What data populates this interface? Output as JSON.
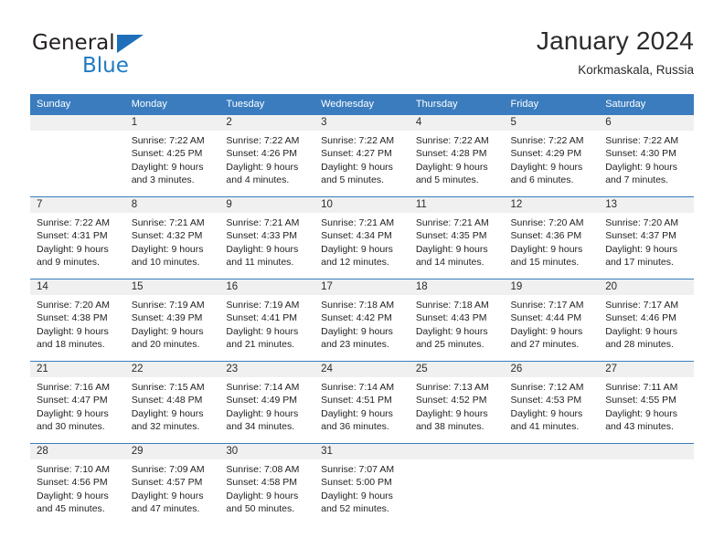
{
  "brand": {
    "name_top": "General",
    "name_bottom": "Blue",
    "triangle_color": "#1e6fba",
    "blue_color": "#1e7bc4"
  },
  "header": {
    "title": "January 2024",
    "subtitle": "Korkmaskala, Russia"
  },
  "colors": {
    "header_row_bg": "#3a7cbe",
    "header_row_text": "#ffffff",
    "daynum_band_bg": "#f0f0f0",
    "week_separator": "#3a7cbe"
  },
  "weekday_headers": [
    "Sunday",
    "Monday",
    "Tuesday",
    "Wednesday",
    "Thursday",
    "Friday",
    "Saturday"
  ],
  "labels": {
    "sunrise_prefix": "Sunrise:",
    "sunset_prefix": "Sunset:",
    "daylight_prefix": "Daylight:"
  },
  "weeks": [
    {
      "days": [
        {
          "date": "",
          "sunrise": "",
          "sunset": "",
          "daylight": "",
          "empty": true
        },
        {
          "date": "1",
          "sunrise": "Sunrise: 7:22 AM",
          "sunset": "Sunset: 4:25 PM",
          "daylight": "Daylight: 9 hours and 3 minutes.",
          "empty": false
        },
        {
          "date": "2",
          "sunrise": "Sunrise: 7:22 AM",
          "sunset": "Sunset: 4:26 PM",
          "daylight": "Daylight: 9 hours and 4 minutes.",
          "empty": false
        },
        {
          "date": "3",
          "sunrise": "Sunrise: 7:22 AM",
          "sunset": "Sunset: 4:27 PM",
          "daylight": "Daylight: 9 hours and 5 minutes.",
          "empty": false
        },
        {
          "date": "4",
          "sunrise": "Sunrise: 7:22 AM",
          "sunset": "Sunset: 4:28 PM",
          "daylight": "Daylight: 9 hours and 5 minutes.",
          "empty": false
        },
        {
          "date": "5",
          "sunrise": "Sunrise: 7:22 AM",
          "sunset": "Sunset: 4:29 PM",
          "daylight": "Daylight: 9 hours and 6 minutes.",
          "empty": false
        },
        {
          "date": "6",
          "sunrise": "Sunrise: 7:22 AM",
          "sunset": "Sunset: 4:30 PM",
          "daylight": "Daylight: 9 hours and 7 minutes.",
          "empty": false
        }
      ]
    },
    {
      "days": [
        {
          "date": "7",
          "sunrise": "Sunrise: 7:22 AM",
          "sunset": "Sunset: 4:31 PM",
          "daylight": "Daylight: 9 hours and 9 minutes.",
          "empty": false
        },
        {
          "date": "8",
          "sunrise": "Sunrise: 7:21 AM",
          "sunset": "Sunset: 4:32 PM",
          "daylight": "Daylight: 9 hours and 10 minutes.",
          "empty": false
        },
        {
          "date": "9",
          "sunrise": "Sunrise: 7:21 AM",
          "sunset": "Sunset: 4:33 PM",
          "daylight": "Daylight: 9 hours and 11 minutes.",
          "empty": false
        },
        {
          "date": "10",
          "sunrise": "Sunrise: 7:21 AM",
          "sunset": "Sunset: 4:34 PM",
          "daylight": "Daylight: 9 hours and 12 minutes.",
          "empty": false
        },
        {
          "date": "11",
          "sunrise": "Sunrise: 7:21 AM",
          "sunset": "Sunset: 4:35 PM",
          "daylight": "Daylight: 9 hours and 14 minutes.",
          "empty": false
        },
        {
          "date": "12",
          "sunrise": "Sunrise: 7:20 AM",
          "sunset": "Sunset: 4:36 PM",
          "daylight": "Daylight: 9 hours and 15 minutes.",
          "empty": false
        },
        {
          "date": "13",
          "sunrise": "Sunrise: 7:20 AM",
          "sunset": "Sunset: 4:37 PM",
          "daylight": "Daylight: 9 hours and 17 minutes.",
          "empty": false
        }
      ]
    },
    {
      "days": [
        {
          "date": "14",
          "sunrise": "Sunrise: 7:20 AM",
          "sunset": "Sunset: 4:38 PM",
          "daylight": "Daylight: 9 hours and 18 minutes.",
          "empty": false
        },
        {
          "date": "15",
          "sunrise": "Sunrise: 7:19 AM",
          "sunset": "Sunset: 4:39 PM",
          "daylight": "Daylight: 9 hours and 20 minutes.",
          "empty": false
        },
        {
          "date": "16",
          "sunrise": "Sunrise: 7:19 AM",
          "sunset": "Sunset: 4:41 PM",
          "daylight": "Daylight: 9 hours and 21 minutes.",
          "empty": false
        },
        {
          "date": "17",
          "sunrise": "Sunrise: 7:18 AM",
          "sunset": "Sunset: 4:42 PM",
          "daylight": "Daylight: 9 hours and 23 minutes.",
          "empty": false
        },
        {
          "date": "18",
          "sunrise": "Sunrise: 7:18 AM",
          "sunset": "Sunset: 4:43 PM",
          "daylight": "Daylight: 9 hours and 25 minutes.",
          "empty": false
        },
        {
          "date": "19",
          "sunrise": "Sunrise: 7:17 AM",
          "sunset": "Sunset: 4:44 PM",
          "daylight": "Daylight: 9 hours and 27 minutes.",
          "empty": false
        },
        {
          "date": "20",
          "sunrise": "Sunrise: 7:17 AM",
          "sunset": "Sunset: 4:46 PM",
          "daylight": "Daylight: 9 hours and 28 minutes.",
          "empty": false
        }
      ]
    },
    {
      "days": [
        {
          "date": "21",
          "sunrise": "Sunrise: 7:16 AM",
          "sunset": "Sunset: 4:47 PM",
          "daylight": "Daylight: 9 hours and 30 minutes.",
          "empty": false
        },
        {
          "date": "22",
          "sunrise": "Sunrise: 7:15 AM",
          "sunset": "Sunset: 4:48 PM",
          "daylight": "Daylight: 9 hours and 32 minutes.",
          "empty": false
        },
        {
          "date": "23",
          "sunrise": "Sunrise: 7:14 AM",
          "sunset": "Sunset: 4:49 PM",
          "daylight": "Daylight: 9 hours and 34 minutes.",
          "empty": false
        },
        {
          "date": "24",
          "sunrise": "Sunrise: 7:14 AM",
          "sunset": "Sunset: 4:51 PM",
          "daylight": "Daylight: 9 hours and 36 minutes.",
          "empty": false
        },
        {
          "date": "25",
          "sunrise": "Sunrise: 7:13 AM",
          "sunset": "Sunset: 4:52 PM",
          "daylight": "Daylight: 9 hours and 38 minutes.",
          "empty": false
        },
        {
          "date": "26",
          "sunrise": "Sunrise: 7:12 AM",
          "sunset": "Sunset: 4:53 PM",
          "daylight": "Daylight: 9 hours and 41 minutes.",
          "empty": false
        },
        {
          "date": "27",
          "sunrise": "Sunrise: 7:11 AM",
          "sunset": "Sunset: 4:55 PM",
          "daylight": "Daylight: 9 hours and 43 minutes.",
          "empty": false
        }
      ]
    },
    {
      "days": [
        {
          "date": "28",
          "sunrise": "Sunrise: 7:10 AM",
          "sunset": "Sunset: 4:56 PM",
          "daylight": "Daylight: 9 hours and 45 minutes.",
          "empty": false
        },
        {
          "date": "29",
          "sunrise": "Sunrise: 7:09 AM",
          "sunset": "Sunset: 4:57 PM",
          "daylight": "Daylight: 9 hours and 47 minutes.",
          "empty": false
        },
        {
          "date": "30",
          "sunrise": "Sunrise: 7:08 AM",
          "sunset": "Sunset: 4:58 PM",
          "daylight": "Daylight: 9 hours and 50 minutes.",
          "empty": false
        },
        {
          "date": "31",
          "sunrise": "Sunrise: 7:07 AM",
          "sunset": "Sunset: 5:00 PM",
          "daylight": "Daylight: 9 hours and 52 minutes.",
          "empty": false
        },
        {
          "date": "",
          "sunrise": "",
          "sunset": "",
          "daylight": "",
          "empty": true
        },
        {
          "date": "",
          "sunrise": "",
          "sunset": "",
          "daylight": "",
          "empty": true
        },
        {
          "date": "",
          "sunrise": "",
          "sunset": "",
          "daylight": "",
          "empty": true
        }
      ]
    }
  ]
}
